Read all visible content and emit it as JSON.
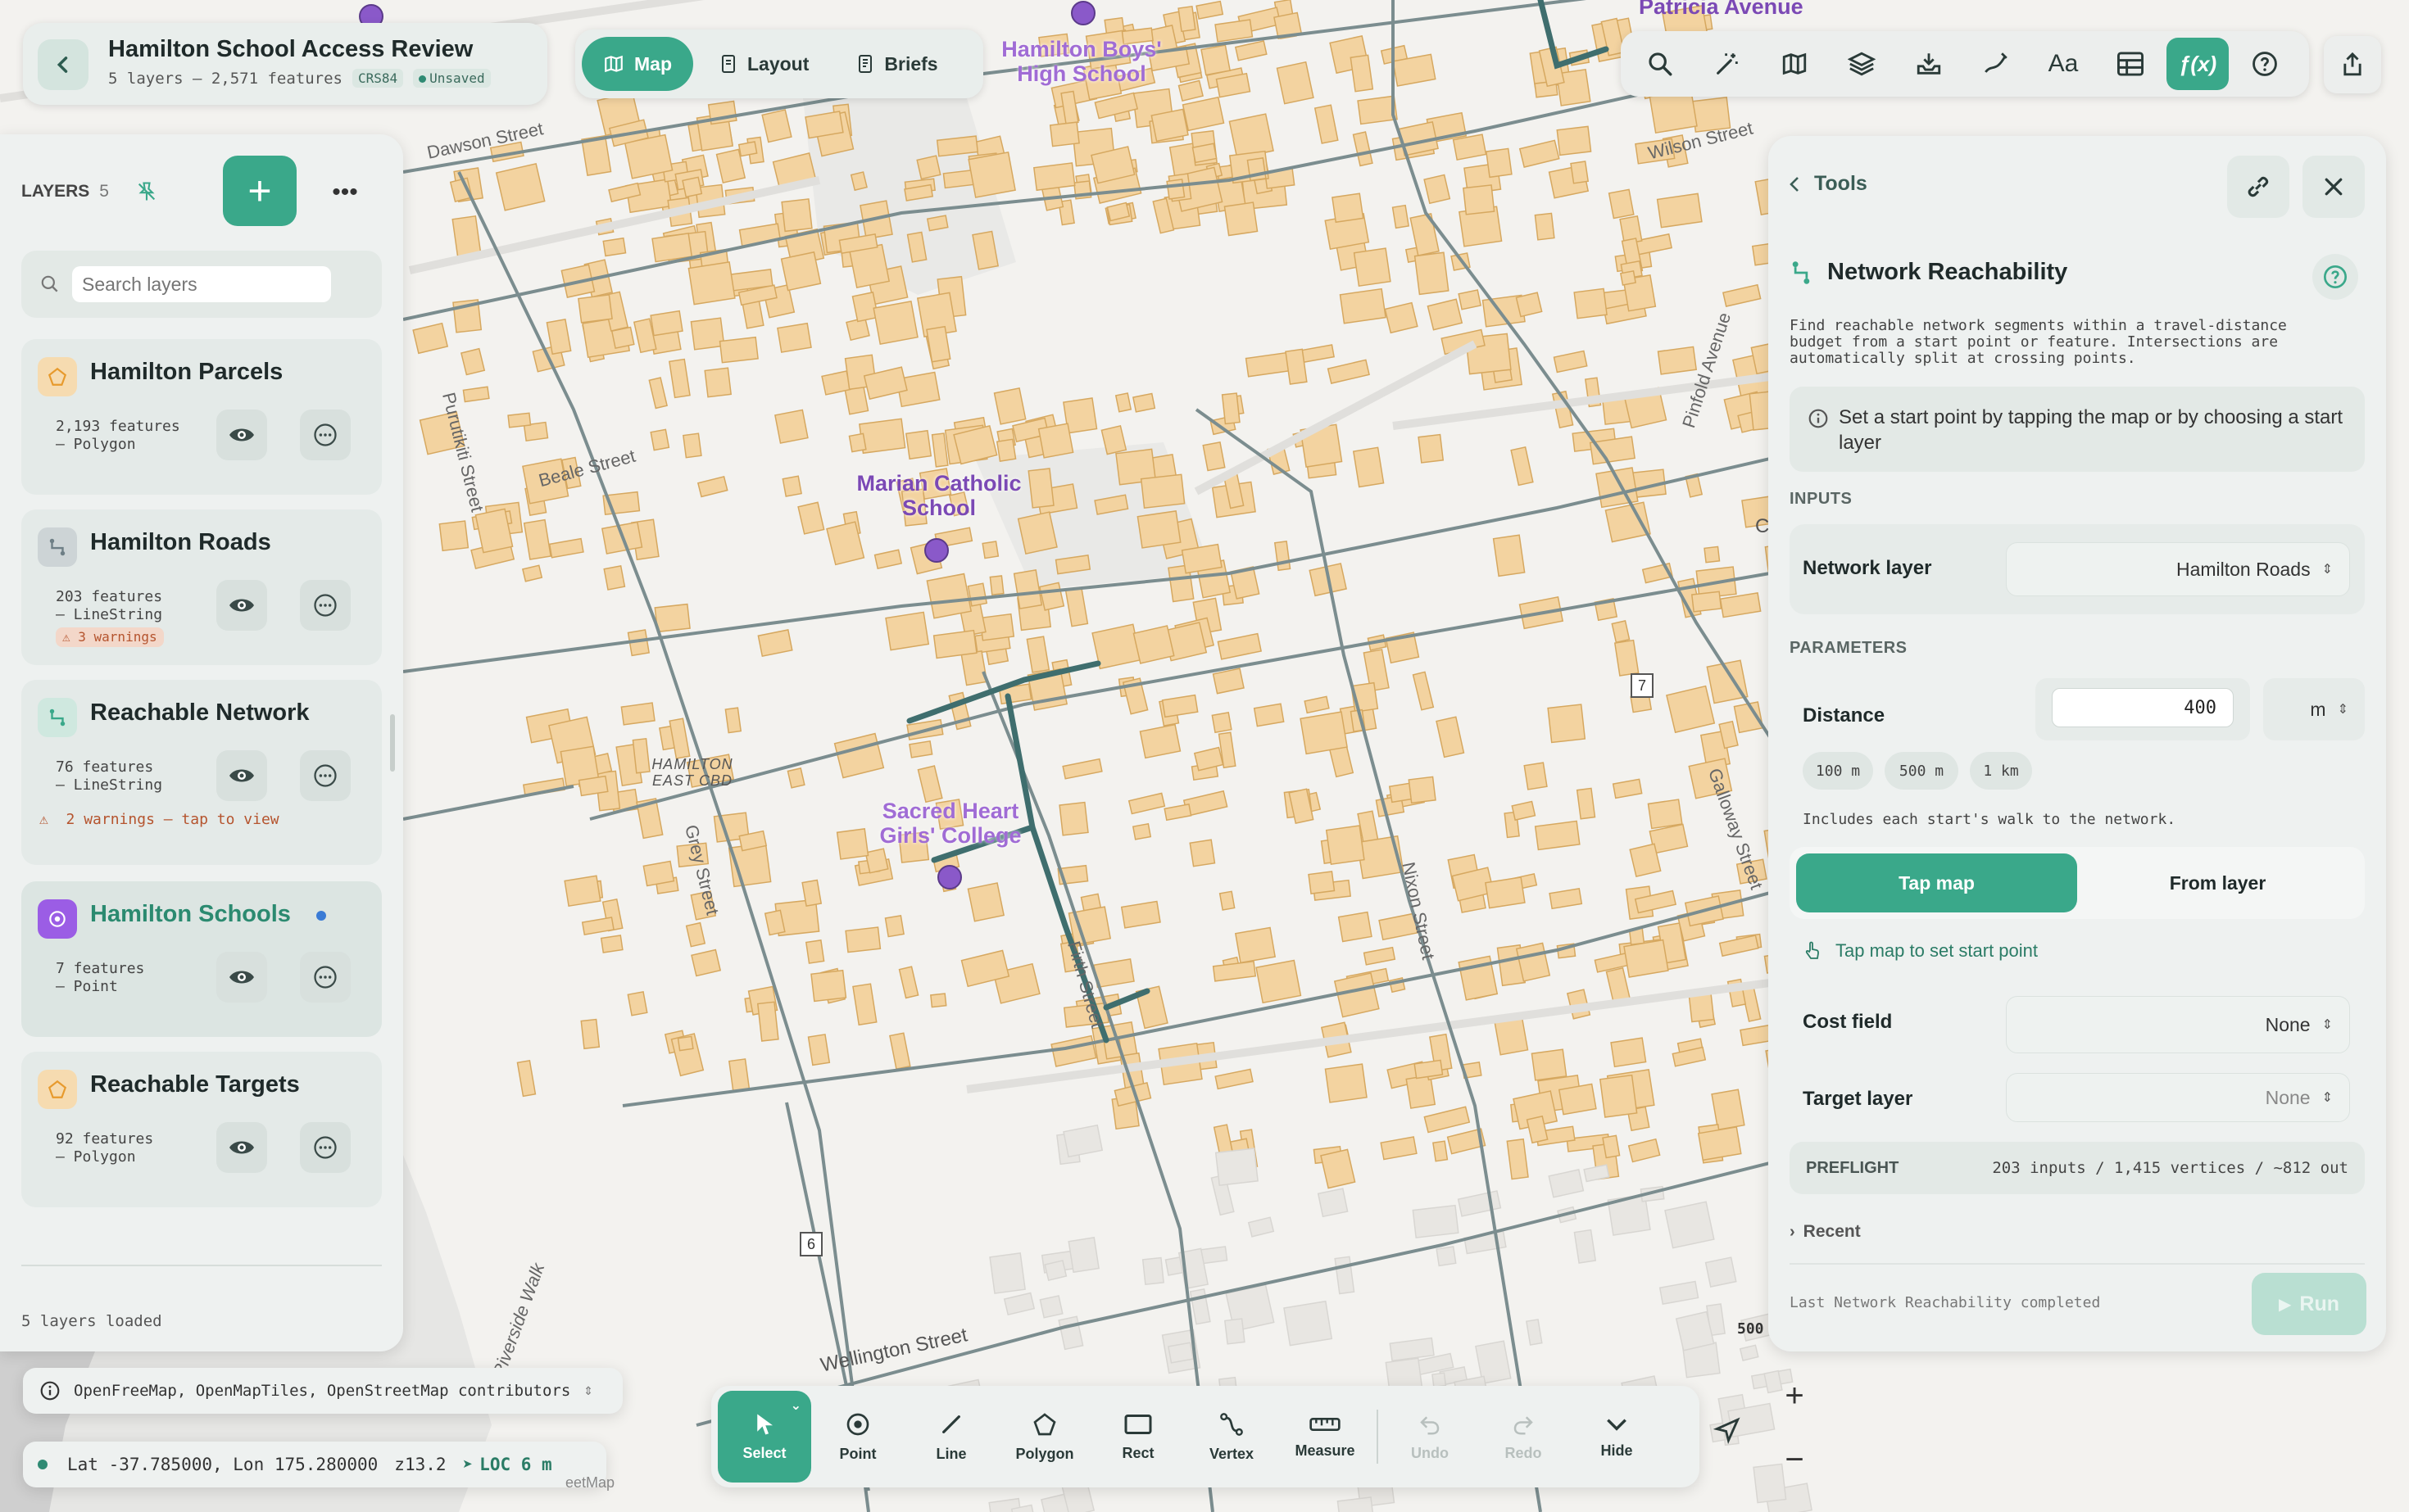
{
  "header": {
    "title": "Hamilton School Access Review",
    "summary": "5 layers – 2,571 features",
    "crs": "CRS84",
    "status": "Unsaved"
  },
  "modes": [
    {
      "label": "Map",
      "icon": "map-icon",
      "active": true
    },
    {
      "label": "Layout",
      "icon": "layout-icon",
      "active": false
    },
    {
      "label": "Briefs",
      "icon": "briefs-icon",
      "active": false
    }
  ],
  "toolbar": {
    "items": [
      "search-icon",
      "magic-wand-icon",
      "basemap-icon",
      "layers-icon",
      "import-icon",
      "draw-icon",
      "labels-icon",
      "table-icon",
      "function-icon",
      "help-icon"
    ],
    "labels_text": "Aa",
    "function_text": "ƒ(x)",
    "active": "function-icon"
  },
  "layers_panel": {
    "title": "LAYERS",
    "count": "5",
    "search_placeholder": "Search layers",
    "status": "5 layers loaded",
    "layers": [
      {
        "name": "Hamilton Parcels",
        "meta": "2,193 features\n– Polygon",
        "type": "polygon",
        "color": "#f1b25a",
        "warning_badge": "",
        "warning_line": ""
      },
      {
        "name": "Hamilton Roads",
        "meta": "203 features\n– LineString",
        "type": "line",
        "color": "#6e7f86",
        "warning_badge": "3 warnings",
        "warning_line": ""
      },
      {
        "name": "Reachable Network",
        "meta": "76 features\n– LineString",
        "type": "line",
        "color": "#3aa88a",
        "warning_badge": "",
        "warning_line": "2 warnings – tap to view"
      },
      {
        "name": "Hamilton Schools",
        "meta": "7 features\n– Point",
        "type": "point",
        "color": "#9b5de5",
        "warning_badge": "",
        "warning_line": "",
        "selected": true
      },
      {
        "name": "Reachable Targets",
        "meta": "92 features\n– Polygon",
        "type": "polygon",
        "color": "#f1b25a",
        "warning_badge": "",
        "warning_line": ""
      }
    ]
  },
  "tools_panel": {
    "back_label": "Tools",
    "tool_title": "Network Reachability",
    "description": "Find reachable network segments within a travel-distance budget from a start point or feature. Intersections are automatically split at crossing points.",
    "hint": "Set a start point by tapping the map or by choosing a start layer",
    "inputs_title": "INPUTS",
    "network_layer_label": "Network layer",
    "network_layer_value": "Hamilton Roads",
    "parameters_title": "PARAMETERS",
    "distance_label": "Distance",
    "distance_value": "400",
    "distance_unit": "m",
    "chips": [
      "100 m",
      "500 m",
      "1 km"
    ],
    "distance_note": "Includes each start's walk to the network.",
    "start_modes": [
      "Tap map",
      "From layer"
    ],
    "tap_hint": "Tap map to set start point",
    "cost_field_label": "Cost field",
    "cost_field_value": "None",
    "target_layer_label": "Target layer",
    "target_layer_value": "None",
    "preflight_label": "PREFLIGHT",
    "preflight_value": "203 inputs / 1,415 vertices / ~812 out",
    "recent_label": "Recent",
    "last_run": "Last Network Reachability completed",
    "run_label": "Run"
  },
  "map": {
    "labels": {
      "school1": [
        "Hamilton Boys'",
        "High School"
      ],
      "school2": [
        "Marian Catholic",
        "School"
      ],
      "school3": [
        "Sacred Heart",
        "Girls' College"
      ],
      "patricia": "Patricia Avenue",
      "cbd": [
        "HAMILTON",
        "EAST CBD"
      ],
      "streets": [
        "Dawson Street",
        "Beale Street",
        "Wilson Street",
        "Pinfold Avenue",
        "Grey Street",
        "Firth Street",
        "Nixon Street",
        "Galloway Street",
        "Wellington Street",
        "Purutikiti Street",
        "Riverside Walk"
      ],
      "route_shields": [
        "7",
        "6"
      ],
      "edge_c": "C"
    },
    "scale_label": "500",
    "attribution": "OpenFreeMap, OpenMapTiles, OpenStreetMap contributors",
    "coords": "Lat -37.785000, Lon 175.280000",
    "zoom": "z13.2",
    "loc": "LOC 6 m",
    "partial_attrib": "eetMap"
  },
  "drawbar": {
    "tools": [
      {
        "label": "Select",
        "icon": "cursor-icon",
        "active": true
      },
      {
        "label": "Point",
        "icon": "point-icon"
      },
      {
        "label": "Line",
        "icon": "line-icon"
      },
      {
        "label": "Polygon",
        "icon": "polygon-icon"
      },
      {
        "label": "Rect",
        "icon": "rect-icon"
      },
      {
        "label": "Vertex",
        "icon": "vertex-icon"
      },
      {
        "label": "Measure",
        "icon": "measure-icon"
      },
      {
        "label": "Undo",
        "icon": "undo-icon",
        "disabled": true
      },
      {
        "label": "Redo",
        "icon": "redo-icon",
        "disabled": true
      },
      {
        "label": "Hide",
        "icon": "chevron-down-icon"
      }
    ]
  },
  "colors": {
    "accent": "#3aa88a",
    "building_fill": "#f3d3a0",
    "building_stroke": "#d6a860",
    "reachable_line": "#3f6e6e",
    "school_point": "#9b5de5",
    "warning": "#b5542e"
  }
}
